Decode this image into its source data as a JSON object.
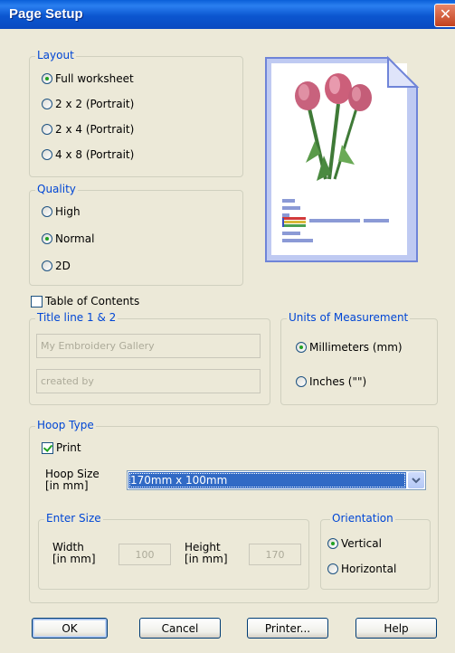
{
  "window": {
    "title": "Page Setup",
    "close_glyph": "✕"
  },
  "layout": {
    "label": "Layout",
    "options": [
      "Full worksheet",
      "2 x 2 (Portrait)",
      "2 x 4 (Portrait)",
      "4 x 8 (Portrait)"
    ],
    "selected": 0
  },
  "quality": {
    "label": "Quality",
    "options": [
      "High",
      "Normal",
      "2D"
    ],
    "selected": 1
  },
  "toc": {
    "label": "Table of Contents",
    "checked": false
  },
  "title_lines": {
    "label": "Title line 1 & 2",
    "line1": "My Embroidery Gallery",
    "line2": "created by"
  },
  "units": {
    "label": "Units of Measurement",
    "options": [
      "Millimeters (mm)",
      "Inches (\"\")"
    ],
    "selected": 0
  },
  "hoop": {
    "label": "Hoop Type",
    "print_label": "Print",
    "print_checked": true,
    "size_label": "Hoop Size\n[in mm]",
    "size_value": "170mm x 100mm"
  },
  "enter_size": {
    "label": "Enter Size",
    "width_label": "Width\n[in mm]",
    "width_value": "100",
    "height_label": "Height\n[in mm]",
    "height_value": "170"
  },
  "orientation": {
    "label": "Orientation",
    "options": [
      "Vertical",
      "Horizontal"
    ],
    "selected": 0
  },
  "buttons": {
    "ok": "OK",
    "cancel": "Cancel",
    "printer": "Printer...",
    "help": "Help"
  },
  "colors": {
    "group_label": "#0046d5",
    "titlebar": "#0a5fd8",
    "selection": "#316ac5",
    "radio_dot": "#21a121"
  }
}
